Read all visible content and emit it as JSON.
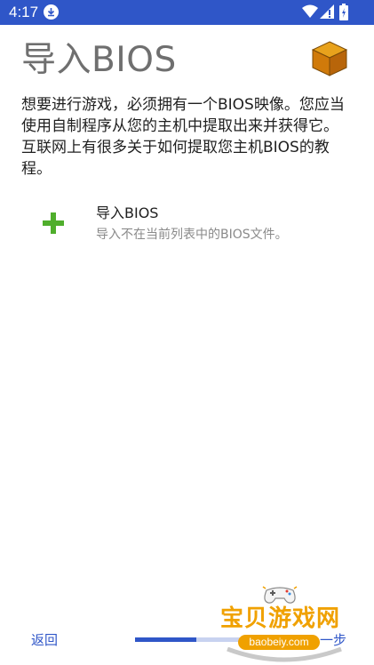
{
  "statusbar": {
    "time": "4:17",
    "download_icon": "download-icon",
    "wifi_icon": "wifi-icon",
    "signal_icon": "cell-signal-icon",
    "battery_icon": "battery-charging-icon"
  },
  "header": {
    "title": "导入BIOS",
    "cube_icon": "bios-cube-icon"
  },
  "description": "想要进行游戏，必须拥有一个BIOS映像。您应当使用自制程序从您的主机中提取出来并获得它。互联网上有很多关于如何提取您主机BIOS的教程。",
  "import": {
    "icon": "plus-icon",
    "title": "导入BIOS",
    "subtitle": "导入不在当前列表中的BIOS文件。"
  },
  "footer": {
    "back_label": "返回",
    "next_label": "一步",
    "progress": 0.55
  },
  "watermark": {
    "name": "宝贝游戏网",
    "url": "baobeiy.com"
  },
  "colors": {
    "statusbar": "#2f56c8",
    "accent": "#2f56c8",
    "plus": "#4fae2c",
    "watermark": "#f0a100"
  }
}
